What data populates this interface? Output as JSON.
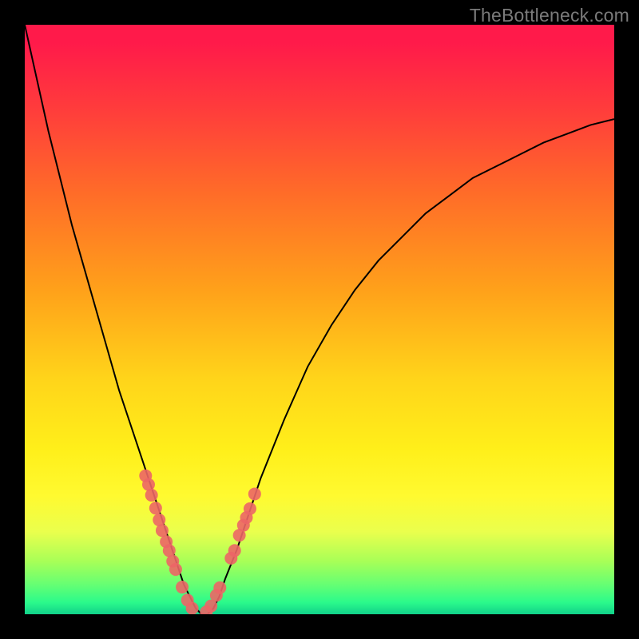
{
  "watermark": "TheBottleneck.com",
  "colors": {
    "background": "#000000",
    "gradient_top": "#ff1a4a",
    "gradient_bottom": "#11d18a",
    "curve": "#000000",
    "marker": "#ec6666"
  },
  "chart_data": {
    "type": "line",
    "title": "",
    "xlabel": "",
    "ylabel": "",
    "xlim": [
      0,
      100
    ],
    "ylim": [
      0,
      100
    ],
    "grid": false,
    "legend": false,
    "series": [
      {
        "name": "bottleneck-curve",
        "x": [
          0,
          2,
          4,
          6,
          8,
          10,
          12,
          14,
          16,
          18,
          20,
          22,
          24,
          25,
          26,
          27,
          28,
          29,
          30,
          31,
          32,
          33,
          34,
          36,
          38,
          40,
          42,
          44,
          48,
          52,
          56,
          60,
          64,
          68,
          72,
          76,
          80,
          84,
          88,
          92,
          96,
          100
        ],
        "y": [
          100,
          91,
          82,
          74,
          66,
          59,
          52,
          45,
          38,
          32,
          26,
          20,
          14,
          11,
          8,
          5,
          3,
          1,
          0,
          0,
          1,
          3,
          6,
          11,
          17,
          23,
          28,
          33,
          42,
          49,
          55,
          60,
          64,
          68,
          71,
          74,
          76,
          78,
          80,
          81.5,
          83,
          84
        ]
      }
    ],
    "markers": {
      "name": "highlight-points",
      "x": [
        20.5,
        21,
        21.5,
        22.2,
        22.8,
        23.3,
        24,
        24.5,
        25.1,
        25.6,
        26.7,
        27.6,
        28.4,
        30.8,
        31.6,
        32.5,
        33.1,
        35,
        35.6,
        36.4,
        37.1,
        37.6,
        38.2,
        39.0
      ],
      "y": [
        23.5,
        22,
        20.2,
        18,
        16,
        14.2,
        12.3,
        10.8,
        9.0,
        7.6,
        4.6,
        2.4,
        1.0,
        0.4,
        1.4,
        3.2,
        4.5,
        9.5,
        10.8,
        13.4,
        15.1,
        16.4,
        17.9,
        20.4
      ]
    }
  }
}
